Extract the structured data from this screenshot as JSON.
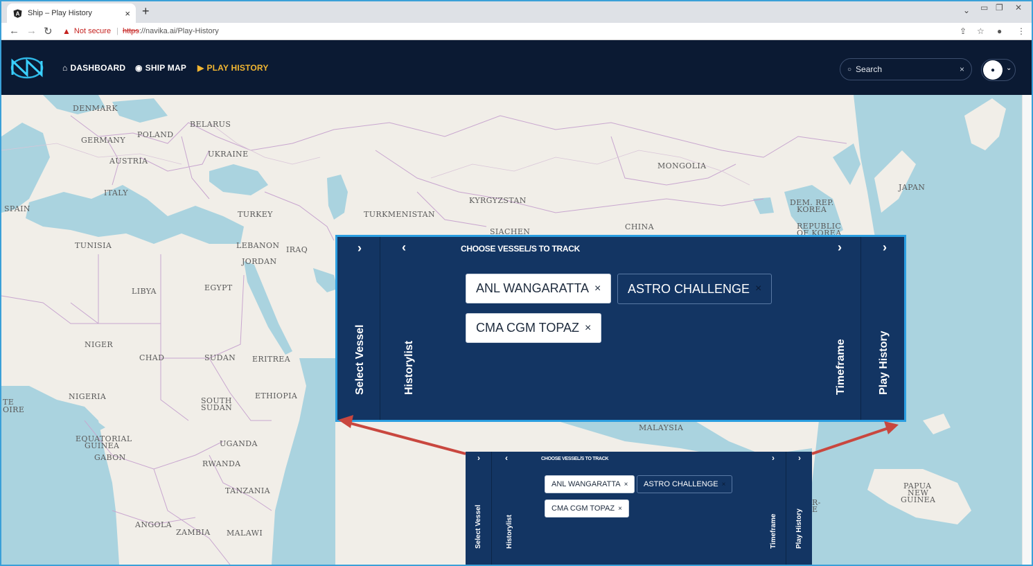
{
  "browser": {
    "tab_title": "Ship – Play History",
    "tab_close": "×",
    "new_tab": "+",
    "security_label": "Not secure",
    "url_scheme": "https",
    "url_rest": "://navika.ai/Play-History"
  },
  "nav": {
    "items": [
      {
        "label": "DASHBOARD",
        "icon": "home-icon"
      },
      {
        "label": "SHIP MAP",
        "icon": "radio-target-icon"
      },
      {
        "label": "PLAY HISTORY",
        "icon": "play-circle-icon",
        "active": true
      }
    ],
    "search_placeholder": "Search",
    "search_clear": "×",
    "active_color": "#f2b632",
    "header_color": "#0b1a33"
  },
  "map": {
    "countries": [
      "DENMARK",
      "BELARUS",
      "POLAND",
      "GERMANY",
      "UKRAINE",
      "AUSTRIA",
      "MONGOLIA",
      "JAPAN",
      "ITALY",
      "SPAIN",
      "KYRGYZSTAN",
      "TURKEY",
      "TURKMENISTAN",
      "DEM. REP.",
      "KOREA",
      "REPUBLIC",
      "OF KOREA",
      "CHINA",
      "SIACHEN",
      "TUNISIA",
      "LEBANON",
      "IRAQ",
      "JORDAN",
      "LIBYA",
      "EGYPT",
      "NIGER",
      "CHAD",
      "SUDAN",
      "ERITREA",
      "NIGERIA",
      "ETHIOPIA",
      "TE",
      "OIRE",
      "SOUTH",
      "SUDAN",
      "EQUATORIAL",
      "GUINEA",
      "GABON",
      "UGANDA",
      "RWANDA",
      "TANZANIA",
      "ANGOLA",
      "ZAMBIA",
      "MALAWI",
      "MALAYSIA",
      "PAPUA",
      "NEW",
      "GUINEA",
      "R-",
      "E"
    ]
  },
  "panel": {
    "title": "CHOOSE VESSEL/S TO TRACK",
    "col_select": "Select Vessel",
    "col_history": "Historylist",
    "col_timeframe": "Timeframe",
    "col_play": "Play History",
    "vessels": [
      {
        "name": "ANL WANGARATTA",
        "selected": false
      },
      {
        "name": "ASTRO CHALLENGE",
        "selected": true
      },
      {
        "name": "CMA CGM TOPAZ",
        "selected": false
      }
    ],
    "remove_glyph": "×",
    "panel_color": "#133563",
    "arrow_color": "#c9473f"
  }
}
